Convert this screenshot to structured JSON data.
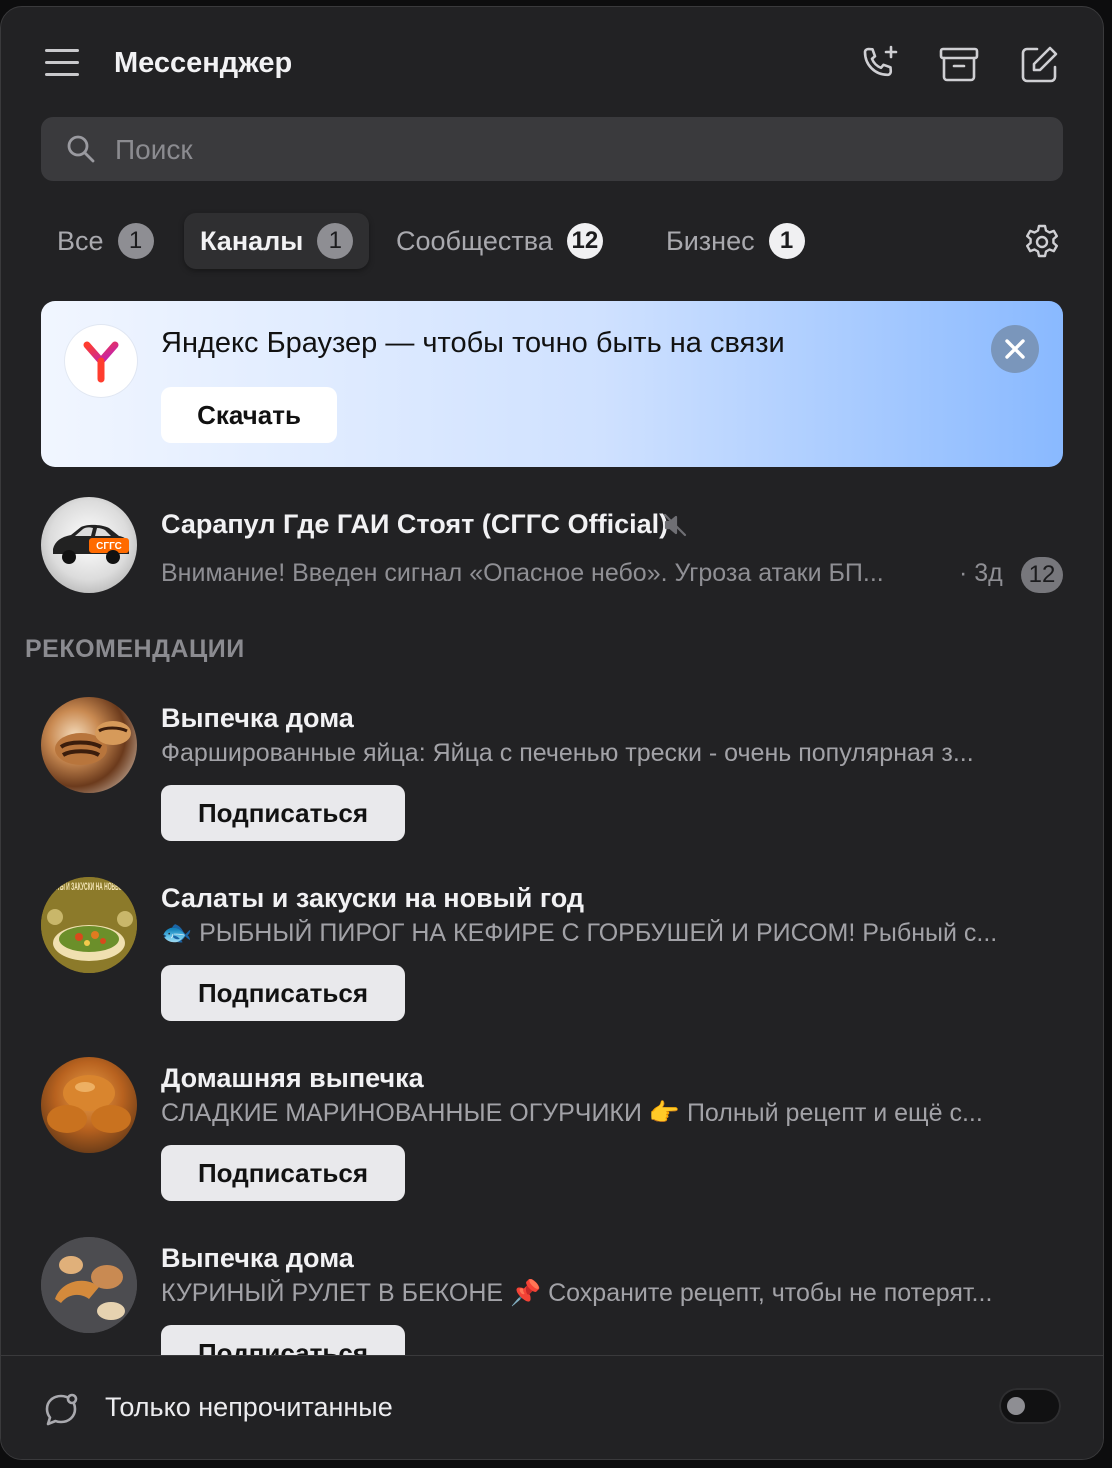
{
  "header": {
    "title": "Мессенджер"
  },
  "search": {
    "placeholder": "Поиск"
  },
  "tabs": [
    {
      "label": "Все",
      "count": "1"
    },
    {
      "label": "Каналы",
      "count": "1",
      "active": true
    },
    {
      "label": "Сообщества",
      "count": "12"
    },
    {
      "label": "Бизнес",
      "count": "1"
    }
  ],
  "banner": {
    "text": "Яндекс Браузер — чтобы точно быть на связи",
    "button": "Скачать"
  },
  "chat": {
    "name": "Сарапул Где ГАИ Стоят (СГГС Official)",
    "message": "Внимание! Введен сигнал «Опасное небо». Угроза атаки БП...",
    "time": "· 3д",
    "unread": "12",
    "muted": true
  },
  "recommendations": {
    "title": "РЕКОМЕНДАЦИИ",
    "items": [
      {
        "name": "Выпечка дома",
        "desc": "Фаршированные яйца: Яйца с печенью трески - очень популярная з...",
        "button": "Подписаться"
      },
      {
        "name": "Салаты и закуски на новый год",
        "desc": "🐟 РЫБНЫЙ ПИРОГ НА КЕФИРЕ С ГОРБУШЕЙ И РИСОМ! Рыбный с...",
        "button": "Подписаться"
      },
      {
        "name": "Домашняя выпечка",
        "desc": "СЛАДКИЕ МАРИНОВАННЫЕ ОГУРЧИКИ 👉 Полный рецепт и ещё с...",
        "button": "Подписаться"
      },
      {
        "name": "Выпечка дома",
        "desc": "КУРИНЫЙ РУЛЕТ В БЕКОНЕ 📌 Сохраните рецепт, чтобы не потерят...",
        "button": "Подписаться"
      }
    ]
  },
  "avatar_texts": {
    "chat": "СГГС",
    "salads": "САЛАТЫ И ЗАКУСКИ НА НОВЫЙ ГОД"
  },
  "footer": {
    "label": "Только непрочитанные",
    "toggle_on": false
  },
  "colors": {
    "background": "#222224",
    "accent_banner": "#89b9ff",
    "badge": "#8e8e93"
  }
}
